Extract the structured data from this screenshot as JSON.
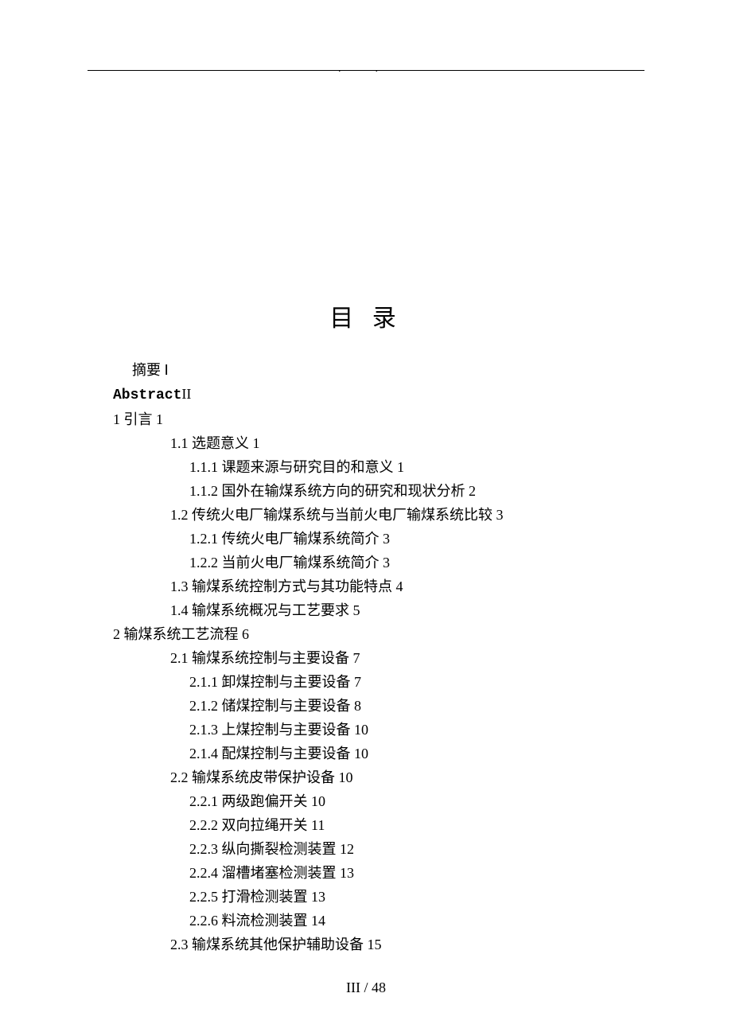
{
  "header_marker": ".          .",
  "title": "目 录",
  "toc": {
    "abstract_zh": {
      "label": "摘要",
      "page": "Ⅰ"
    },
    "abstract_en": {
      "label": "Abstract",
      "page": "II"
    },
    "ch1": {
      "num": "1",
      "title": "引言",
      "page": "1"
    },
    "s1_1": {
      "num": "1.1",
      "title": "选题意义",
      "page": "1"
    },
    "s1_1_1": {
      "num": "1.1.1",
      "title": "课题来源与研究目的和意义",
      "page": "1"
    },
    "s1_1_2": {
      "num": "1.1.2",
      "title": "国外在输煤系统方向的研究和现状分析",
      "page": "2"
    },
    "s1_2": {
      "num": "1.2",
      "title": "传统火电厂输煤系统与当前火电厂输煤系统比较",
      "page": "3"
    },
    "s1_2_1": {
      "num": "1.2.1",
      "title": "传统火电厂输煤系统简介",
      "page": "3"
    },
    "s1_2_2": {
      "num": "1.2.2",
      "title": "当前火电厂输煤系统简介",
      "page": "3"
    },
    "s1_3": {
      "num": "1.3",
      "title": "输煤系统控制方式与其功能特点",
      "page": "4"
    },
    "s1_4": {
      "num": "1.4",
      "title": "输煤系统概况与工艺要求",
      "page": "5"
    },
    "ch2": {
      "num": "2",
      "title": "输煤系统工艺流程",
      "page": "6"
    },
    "s2_1": {
      "num": "2.1",
      "title": "输煤系统控制与主要设备",
      "page": "7"
    },
    "s2_1_1": {
      "num": "2.1.1",
      "title": "卸煤控制与主要设备",
      "page": "7"
    },
    "s2_1_2": {
      "num": "2.1.2",
      "title": " 储煤控制与主要设备",
      "page": "8"
    },
    "s2_1_3": {
      "num": "2.1.3",
      "title": "上煤控制与主要设备",
      "page": "10"
    },
    "s2_1_4": {
      "num": "2.1.4",
      "title": "配煤控制与主要设备",
      "page": "10"
    },
    "s2_2": {
      "num": "2.2",
      "title": "输煤系统皮带保护设备",
      "page": "10"
    },
    "s2_2_1": {
      "num": "2.2.1",
      "title": "两级跑偏开关",
      "page": "10"
    },
    "s2_2_2": {
      "num": "2.2.2",
      "title": "双向拉绳开关",
      "page": "11"
    },
    "s2_2_3": {
      "num": "2.2.3",
      "title": "纵向撕裂检测装置",
      "page": "12"
    },
    "s2_2_4": {
      "num": "2.2.4",
      "title": "溜槽堵塞检测装置",
      "page": "13"
    },
    "s2_2_5": {
      "num": "2.2.5",
      "title": "打滑检测装置",
      "page": "13"
    },
    "s2_2_6": {
      "num": "2.2.6",
      "title": "料流检测装置",
      "page": "14"
    },
    "s2_3": {
      "num": "2.3",
      "title": "输煤系统其他保护辅助设备",
      "page": "15"
    }
  },
  "footer": "III / 48"
}
